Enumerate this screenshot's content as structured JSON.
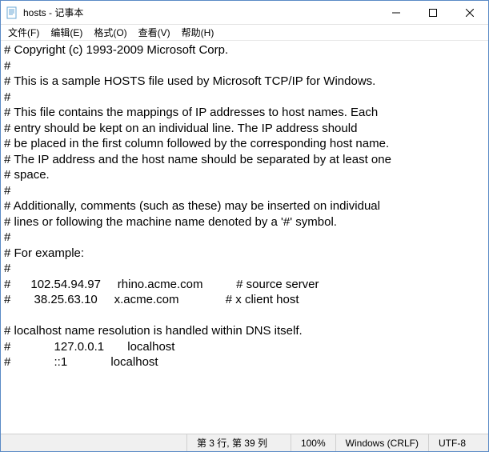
{
  "window": {
    "title": "hosts - 记事本"
  },
  "menu": {
    "file": "文件(F)",
    "edit": "编辑(E)",
    "format": "格式(O)",
    "view": "查看(V)",
    "help": "帮助(H)"
  },
  "content": "# Copyright (c) 1993-2009 Microsoft Corp.\n#\n# This is a sample HOSTS file used by Microsoft TCP/IP for Windows.\n#\n# This file contains the mappings of IP addresses to host names. Each\n# entry should be kept on an individual line. The IP address should\n# be placed in the first column followed by the corresponding host name.\n# The IP address and the host name should be separated by at least one\n# space.\n#\n# Additionally, comments (such as these) may be inserted on individual\n# lines or following the machine name denoted by a '#' symbol.\n#\n# For example:\n#\n#      102.54.94.97     rhino.acme.com          # source server\n#       38.25.63.10     x.acme.com              # x client host\n\n# localhost name resolution is handled within DNS itself.\n#             127.0.0.1       localhost\n#             ::1             localhost",
  "status": {
    "cursor": "第 3 行, 第 39 列",
    "zoom": "100%",
    "lineending": "Windows (CRLF)",
    "encoding": "UTF-8"
  }
}
